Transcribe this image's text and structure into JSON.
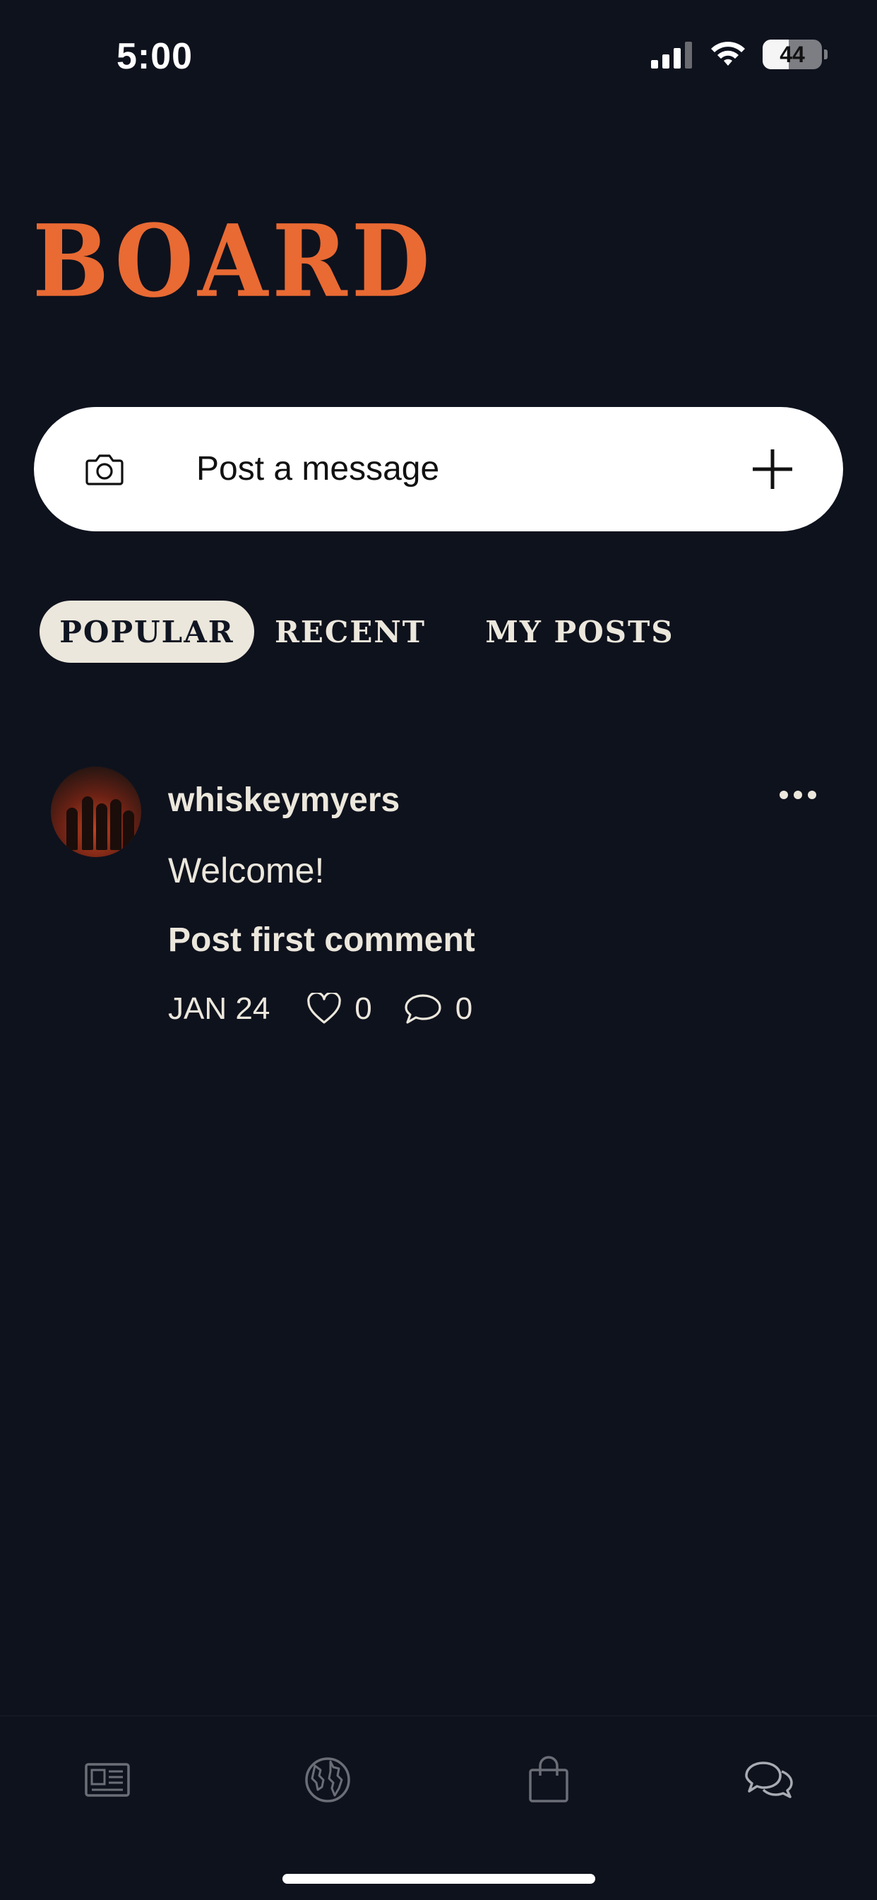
{
  "status_bar": {
    "time": "5:00",
    "battery": "44",
    "battery_level": 0.44
  },
  "header": {
    "title": "BOARD"
  },
  "composer": {
    "placeholder": "Post a message",
    "camera_icon": "camera-icon",
    "add_icon": "plus-icon"
  },
  "tabs": [
    {
      "label": "POPULAR",
      "active": true
    },
    {
      "label": "RECENT",
      "active": false
    },
    {
      "label": "MY POSTS",
      "active": false
    }
  ],
  "post": {
    "username": "whiskeymyers",
    "message": "Welcome!",
    "comment_link": "Post first comment",
    "date": "JAN 24",
    "likes": "0",
    "comments": "0"
  },
  "bottom_nav": [
    {
      "icon": "news-icon"
    },
    {
      "icon": "globe-icon"
    },
    {
      "icon": "shopping-bag-icon"
    },
    {
      "icon": "chat-icon"
    }
  ],
  "colors": {
    "background": "#0e121d",
    "accent": "#e96a33",
    "text": "#ece7dc",
    "active_tab": "#ece7dc"
  }
}
